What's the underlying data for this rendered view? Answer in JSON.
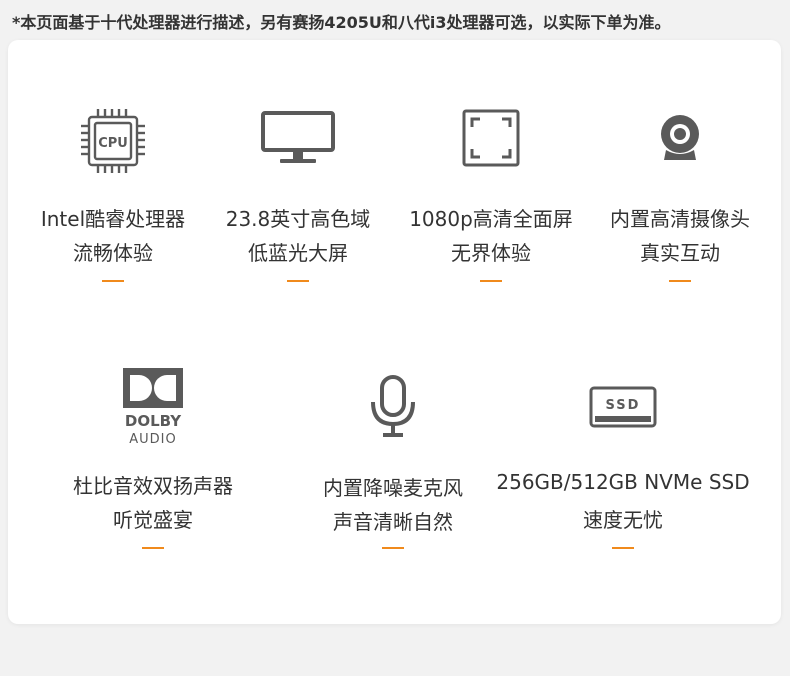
{
  "notice": "*本页面基于十代处理器进行描述，另有赛扬4205U和八代i3处理器可选，以实际下单为准。",
  "features": [
    {
      "icon": "cpu-icon",
      "icon_label": "CPU",
      "line1": "Intel酷睿处理器",
      "line2": "流畅体验"
    },
    {
      "icon": "monitor-icon",
      "line1": "23.8英寸高色域",
      "line2": "低蓝光大屏"
    },
    {
      "icon": "fullscreen-frame-icon",
      "line1": "1080p高清全面屏",
      "line2": "无界体验"
    },
    {
      "icon": "webcam-icon",
      "line1": "内置高清摄像头",
      "line2": "真实互动"
    },
    {
      "icon": "dolby-audio-logo",
      "icon_label_1": "DOLBY",
      "icon_label_2": "AUDIO",
      "line1": "杜比音效双扬声器",
      "line2": "听觉盛宴"
    },
    {
      "icon": "microphone-icon",
      "line1": "内置降噪麦克风",
      "line2": "声音清晰自然"
    },
    {
      "icon": "ssd-icon",
      "icon_label": "SSD",
      "line1": "256GB/512GB NVMe SSD",
      "line2": "速度无忧"
    }
  ],
  "colors": {
    "accent": "#f08a1c",
    "icon": "#5a5a5a",
    "text": "#333333",
    "background": "#f2f2f2",
    "card": "#ffffff"
  }
}
